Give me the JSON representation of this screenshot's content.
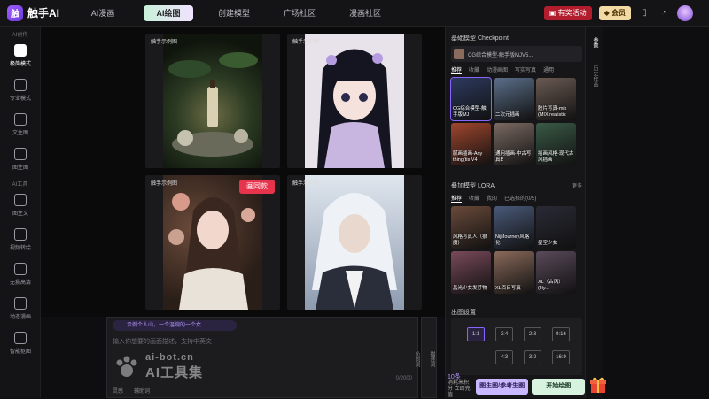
{
  "app": {
    "name": "触手AI",
    "logo_glyph": "触"
  },
  "nav": {
    "tabs": [
      {
        "label": "AI漫画"
      },
      {
        "label": "AI绘图"
      },
      {
        "label": "创建模型"
      },
      {
        "label": "广场社区"
      },
      {
        "label": "漫画社区"
      }
    ],
    "active_index": 1
  },
  "topright": {
    "promo": "有奖活动",
    "member": "会员"
  },
  "sidebar": {
    "cat1": "AI创作",
    "items": [
      {
        "label": "极简模式"
      },
      {
        "label": "专业模式"
      },
      {
        "label": "文生图"
      },
      {
        "label": "图生图"
      }
    ],
    "cat2": "AI工具",
    "tools": [
      {
        "label": "图生文"
      },
      {
        "label": "视频转绘"
      },
      {
        "label": "无损高清"
      },
      {
        "label": "动态漫画"
      },
      {
        "label": "智能抠图"
      }
    ]
  },
  "canvas": {
    "cards": [
      {
        "tag": "触手示例图"
      },
      {
        "tag": "触手示例图"
      },
      {
        "tag": "触手示例图",
        "button": "画同款"
      },
      {
        "tag": "触手示例图"
      }
    ]
  },
  "prompt": {
    "chip": "示例个人山，一个温婉的一个女...",
    "placeholder": "输入你想要的画面描述，支持中英文",
    "count": "0/2000",
    "tools": [
      "灵感",
      "辅助词"
    ]
  },
  "watermark": {
    "line1": "ai-bot.cn",
    "line2": "AI工具集"
  },
  "side_actions": [
    "描述词",
    "负向词"
  ],
  "panel": {
    "checkpoint_title": "基础模型 Checkpoint",
    "checkpoint_value": "CG综合模型-触手版MJV5...",
    "checkpoint_filters": [
      "推荐",
      "收藏",
      "动漫画图",
      "写实写真",
      "通用"
    ],
    "checkpoints": [
      {
        "caption": "CG综合模型-触手版MJ",
        "color": "#2c3a5e"
      },
      {
        "caption": "二次元插画",
        "color": "#5b6f8a"
      },
      {
        "caption": "胶片写真-mix (MIX realistic",
        "color": "#6a5a52"
      },
      {
        "caption": "腻画插画-Any thing(tis V4",
        "color": "#a0462e"
      },
      {
        "caption": "通用插画-中古写真B",
        "color": "#7a6a62"
      },
      {
        "caption": "插画风格-现代古风插画",
        "color": "#3a5a46"
      }
    ],
    "lora_title": "叠加模型 LORA",
    "lora_more": "更多",
    "lora_filters": [
      "推荐",
      "收藏",
      "我的",
      "已选择的(0/5)"
    ],
    "loras": [
      {
        "caption": "风格写真人（狼魔）",
        "color": "#6a4a3a"
      },
      {
        "caption": "NijiJourney风格化",
        "color": "#4a5a7a"
      },
      {
        "caption": "星空少女",
        "color": "#2a2a36"
      },
      {
        "caption": "晶光少女发芽物",
        "color": "#7a4a5a"
      },
      {
        "caption": "XL百日写真",
        "color": "#8a6a5a"
      },
      {
        "caption": "XL（古风）(Hy...",
        "color": "#5a4a5a"
      }
    ],
    "ratio_title": "出图设置",
    "ratios": [
      "1:1",
      "3:4",
      "2:3",
      "9:16",
      "4:3",
      "3:2",
      "16:9"
    ],
    "ratio_selected": "1:1"
  },
  "right_tabs": [
    "参数",
    "历史作品"
  ],
  "gen": {
    "count": "10条",
    "count_sub": "消耗米积分 立即充值",
    "btn_a": "图生图/参考生图",
    "btn_b": "开始绘图"
  }
}
